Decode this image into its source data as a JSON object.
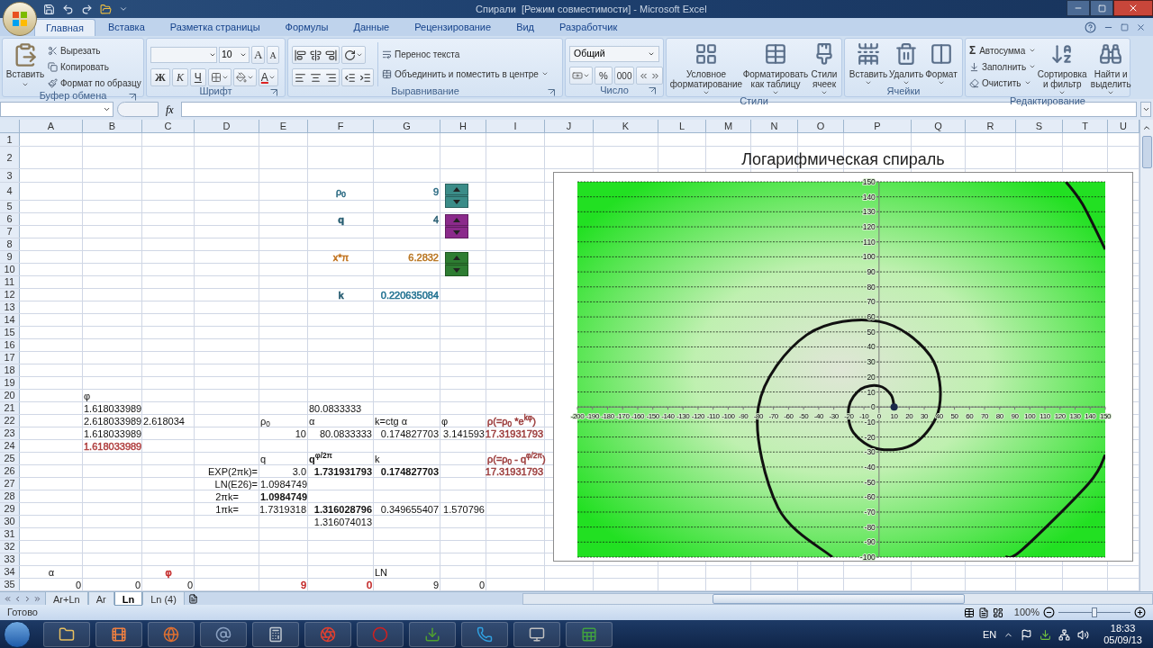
{
  "window": {
    "title": "Спирали  [Режим совместимости] - Microsoft Excel"
  },
  "tabs": [
    {
      "label": "Главная",
      "selected": true
    },
    {
      "label": "Вставка",
      "selected": false
    },
    {
      "label": "Разметка страницы",
      "selected": false
    },
    {
      "label": "Формулы",
      "selected": false
    },
    {
      "label": "Данные",
      "selected": false
    },
    {
      "label": "Рецензирование",
      "selected": false
    },
    {
      "label": "Вид",
      "selected": false
    },
    {
      "label": "Разработчик",
      "selected": false
    }
  ],
  "clipboard": {
    "title": "Буфер обмена",
    "paste": "Вставить",
    "actions": [
      "Вырезать",
      "Копировать",
      "Формат по образцу"
    ]
  },
  "font": {
    "title": "Шрифт",
    "size": "10",
    "grow": "A",
    "shrink": "A",
    "bold": "Ж",
    "italic": "К",
    "underline": "Ч",
    "color_letter": "A"
  },
  "alignment": {
    "title": "Выравнивание",
    "wrap": "Перенос текста",
    "merge": "Объединить и поместить в центре"
  },
  "number": {
    "title": "Число",
    "format": "Общий",
    "percent": "%",
    "thousands": "000"
  },
  "styles": {
    "title": "Стили",
    "buttons": [
      "Условное форматирование",
      "Форматировать как таблицу",
      "Стили ячеек"
    ]
  },
  "cells_group": {
    "title": "Ячейки",
    "buttons": [
      "Вставить",
      "Удалить",
      "Формат"
    ]
  },
  "editing": {
    "title": "Редактирование",
    "sum_symbol": "Σ",
    "actions": [
      "Автосумма",
      "Заполнить",
      "Очистить"
    ],
    "buttons": [
      "Сортировка и фильтр",
      "Найти и выделить"
    ]
  },
  "formula_bar": {
    "fx": "fx"
  },
  "sheet": {
    "columns": [
      "A",
      "B",
      "C",
      "D",
      "E",
      "F",
      "G",
      "H",
      "I",
      "J",
      "K",
      "L",
      "M",
      "N",
      "O",
      "P",
      "Q",
      "R",
      "S",
      "T",
      "U"
    ],
    "rows": [
      {
        "label": "1"
      },
      {
        "label": "2"
      },
      {
        "label": "3"
      },
      {
        "label": "4",
        "cells": {
          "F": {
            "kind": "centered",
            "text": "ρ$_{0}$",
            "color": "#2a6a82"
          },
          "G": {
            "kind": "number",
            "text": "9",
            "color": "#2a6a82"
          },
          "H": {
            "kind": "spinner",
            "color": "#3b8c88"
          }
        }
      },
      {
        "label": "5"
      },
      {
        "label": "6",
        "cells": {
          "F": {
            "kind": "centered",
            "text": "q",
            "bold": true,
            "color": "#2a5f73"
          },
          "G": {
            "kind": "number",
            "text": "4",
            "color": "#2a5f73"
          },
          "H": {
            "kind": "spinner",
            "color": "#8b2a8b"
          }
        }
      },
      {
        "label": "7"
      },
      {
        "label": "8"
      },
      {
        "label": "9",
        "cells": {
          "F": {
            "kind": "centered",
            "text": "x*π",
            "color": "#c0701a"
          },
          "G": {
            "kind": "number",
            "text": "6.2832",
            "color": "#b8741f"
          },
          "H": {
            "kind": "spinner",
            "color": "#2e7d32"
          }
        }
      },
      {
        "label": "10"
      },
      {
        "label": "11"
      },
      {
        "label": "12",
        "cells": {
          "F": {
            "kind": "centered",
            "text": "k",
            "bold": true,
            "color": "#2a5f73"
          },
          "G": {
            "kind": "number",
            "text": "0.220635084",
            "color": "#1d6f8f"
          }
        }
      },
      {
        "label": "13"
      },
      {
        "label": "14"
      },
      {
        "label": "15"
      },
      {
        "label": "16"
      },
      {
        "label": "17"
      },
      {
        "label": "18"
      },
      {
        "label": "19"
      },
      {
        "label": "20",
        "cells": {
          "B": {
            "kind": "text",
            "text": "φ"
          }
        }
      },
      {
        "label": "21",
        "cells": {
          "B": {
            "kind": "text",
            "text": "1.618033989"
          },
          "F": {
            "kind": "text",
            "text": "80.0833333"
          }
        }
      },
      {
        "label": "22",
        "cells": {
          "B": {
            "kind": "text",
            "text": "2.618033989"
          },
          "C": {
            "kind": "text",
            "text": "2.618034"
          },
          "E": {
            "kind": "text",
            "text": "ρ$_{0}$"
          },
          "F": {
            "kind": "text",
            "text": "α"
          },
          "G": {
            "kind": "text",
            "text": "k=ctg α"
          },
          "H": {
            "kind": "text",
            "text": "φ"
          },
          "I": {
            "kind": "text",
            "text": "ρ(=ρ$_{0}$ *e$^{kφ}$)",
            "color": "#9b3b3b"
          }
        }
      },
      {
        "label": "23",
        "cells": {
          "B": {
            "kind": "text",
            "text": "1.618033989"
          },
          "E": {
            "kind": "number",
            "text": "10"
          },
          "F": {
            "kind": "number",
            "text": "80.0833333"
          },
          "G": {
            "kind": "number",
            "text": "0.174827703"
          },
          "H": {
            "kind": "number",
            "text": "3.141593"
          },
          "I": {
            "kind": "number",
            "text": "17.31931793",
            "color": "#9b3b3b"
          }
        }
      },
      {
        "label": "24",
        "cells": {
          "B": {
            "kind": "text",
            "text": "1.618033989",
            "color": "#b04040"
          }
        }
      },
      {
        "label": "25",
        "cells": {
          "E": {
            "kind": "text",
            "text": "q"
          },
          "F": {
            "kind": "text",
            "text": "q$^{φ/2π}$",
            "bold": true
          },
          "G": {
            "kind": "text",
            "text": "k"
          },
          "I": {
            "kind": "text",
            "text": "ρ(=ρ$_{0}$ - q$^{φ/2π}$)",
            "color": "#9b3b3b"
          }
        }
      },
      {
        "label": "26",
        "cells": {
          "D": {
            "kind": "number",
            "text": "EXP(2πk)="
          },
          "E": {
            "kind": "number",
            "text": "3.0"
          },
          "F": {
            "kind": "number",
            "text": "1.731931793",
            "bold": true
          },
          "G": {
            "kind": "number",
            "text": "0.174827703",
            "bold": true
          },
          "I": {
            "kind": "number",
            "text": "17.31931793",
            "color": "#9b3b3b"
          }
        }
      },
      {
        "label": "27",
        "cells": {
          "D": {
            "kind": "number",
            "text": "LN(E26)="
          },
          "E": {
            "kind": "text",
            "text": "1.0984749"
          }
        }
      },
      {
        "label": "28",
        "cells": {
          "D": {
            "kind": "centered",
            "text": "2πk="
          },
          "E": {
            "kind": "text",
            "text": "1.0984749",
            "bold": true
          }
        }
      },
      {
        "label": "29",
        "cells": {
          "D": {
            "kind": "centered",
            "text": "1πk="
          },
          "E": {
            "kind": "number",
            "text": "1.7319318"
          },
          "F": {
            "kind": "number",
            "text": "1.316028796",
            "bold": true
          },
          "G": {
            "kind": "number",
            "text": "0.349655407"
          },
          "H": {
            "kind": "number",
            "text": "1.570796"
          }
        }
      },
      {
        "label": "30",
        "cells": {
          "F": {
            "kind": "number",
            "text": "1.316074013"
          }
        }
      },
      {
        "label": "31"
      },
      {
        "label": "32"
      },
      {
        "label": "33"
      },
      {
        "label": "34",
        "cells": {
          "A": {
            "kind": "centered",
            "text": "α"
          },
          "C": {
            "kind": "centered",
            "text": "φ",
            "color": "#c02020"
          },
          "G": {
            "kind": "text",
            "text": "LN"
          }
        }
      },
      {
        "label": "35",
        "cells": {
          "A": {
            "kind": "number",
            "text": "0"
          },
          "B": {
            "kind": "number",
            "text": "0"
          },
          "C": {
            "kind": "number",
            "text": "0"
          },
          "E": {
            "kind": "number",
            "text": "9",
            "color": "#c02020"
          },
          "F": {
            "kind": "number",
            "text": "0",
            "color": "#c02020"
          },
          "G": {
            "kind": "number",
            "text": "9"
          },
          "H": {
            "kind": "number",
            "text": "0"
          }
        }
      }
    ]
  },
  "chart": {
    "chart_data": {
      "type": "line",
      "title": "Логарифмическая спираль",
      "grid": true,
      "x": [
        10,
        8,
        0,
        -12,
        -20,
        -17,
        0,
        24,
        40,
        34,
        0,
        -48,
        -80,
        -67,
        -31,
        null,
        84,
        95,
        139,
        150,
        null,
        150,
        135,
        124
      ],
      "series": [
        {
          "color": "#111111",
          "values": [
            0,
            8,
            14,
            12,
            0,
            -17,
            -28,
            -24,
            0,
            34,
            57,
            48,
            0,
            -67,
            -100,
            null,
            -100,
            -95,
            -51,
            -32,
            null,
            105,
            135,
            150
          ]
        }
      ],
      "xlim": [
        -200,
        150
      ],
      "ylim": [
        -100,
        150
      ],
      "xticks": [
        -200,
        -190,
        -180,
        -170,
        -160,
        -150,
        -140,
        -130,
        -120,
        -110,
        -100,
        -90,
        -80,
        -70,
        -60,
        -50,
        -40,
        -30,
        -20,
        -10,
        0,
        10,
        20,
        30,
        40,
        50,
        60,
        70,
        80,
        90,
        100,
        110,
        120,
        130,
        140,
        150
      ],
      "yticks": [
        -100,
        -90,
        -80,
        -70,
        -60,
        -50,
        -40,
        -30,
        -20,
        -10,
        0,
        10,
        20,
        30,
        40,
        50,
        60,
        70,
        80,
        90,
        100,
        110,
        120,
        130,
        140,
        150
      ]
    }
  },
  "sheet_tabs": [
    {
      "label": "Ar+Ln",
      "selected": false
    },
    {
      "label": "Ar",
      "selected": false
    },
    {
      "label": "Ln",
      "selected": true
    },
    {
      "label": "Ln (4)",
      "selected": false
    }
  ],
  "status_bar": {
    "text": "Готово",
    "zoom": "100%",
    "zoom_slider": {
      "level": 0.5
    }
  },
  "taskbar": {
    "language": "EN",
    "time": "18:33",
    "date": "05/09/13"
  }
}
